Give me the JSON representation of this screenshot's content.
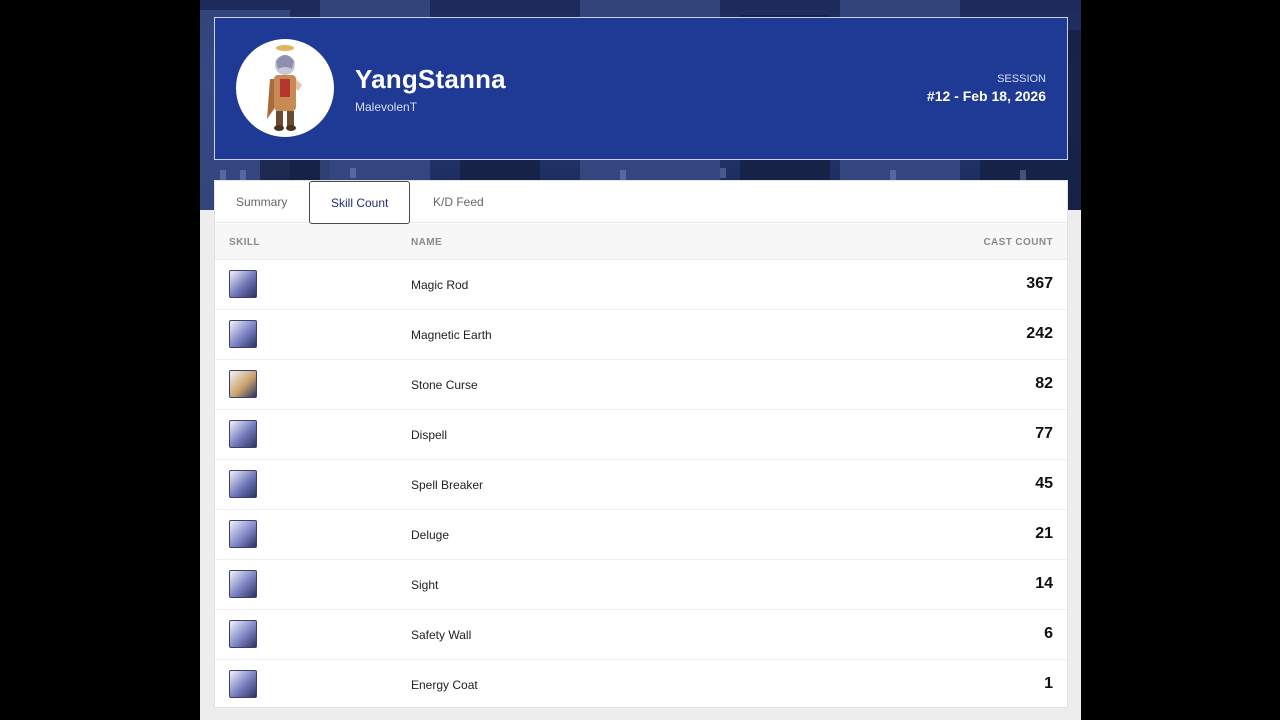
{
  "profile": {
    "player_name": "YangStanna",
    "guild_name": "MalevolenT",
    "session_label": "SESSION",
    "session_value": "#12 - Feb 18, 2026"
  },
  "tabs": [
    {
      "label": "Summary",
      "active": false
    },
    {
      "label": "Skill Count",
      "active": true
    },
    {
      "label": "K/D Feed",
      "active": false
    }
  ],
  "table": {
    "headers": {
      "skill": "SKILL",
      "name": "NAME",
      "cast_count": "CAST COUNT"
    },
    "rows": [
      {
        "icon": "magic-rod-icon",
        "name": "Magic Rod",
        "count": "367",
        "color": "#6d74b8"
      },
      {
        "icon": "magnetic-earth-icon",
        "name": "Magnetic Earth",
        "count": "242",
        "color": "#7a80c4"
      },
      {
        "icon": "stone-curse-icon",
        "name": "Stone Curse",
        "count": "82",
        "color": "#c9a36b"
      },
      {
        "icon": "dispell-icon",
        "name": "Dispell",
        "count": "77",
        "color": "#7179bd"
      },
      {
        "icon": "spell-breaker-icon",
        "name": "Spell Breaker",
        "count": "45",
        "color": "#6f77ba"
      },
      {
        "icon": "deluge-icon",
        "name": "Deluge",
        "count": "21",
        "color": "#8088c8"
      },
      {
        "icon": "sight-icon",
        "name": "Sight",
        "count": "14",
        "color": "#7a82c2"
      },
      {
        "icon": "safety-wall-icon",
        "name": "Safety Wall",
        "count": "6",
        "color": "#7e86c6"
      },
      {
        "icon": "energy-coat-icon",
        "name": "Energy Coat",
        "count": "1",
        "color": "#757dbf"
      }
    ]
  },
  "colors": {
    "banner": "#1f3a94",
    "accent": "#1f2f6e"
  }
}
